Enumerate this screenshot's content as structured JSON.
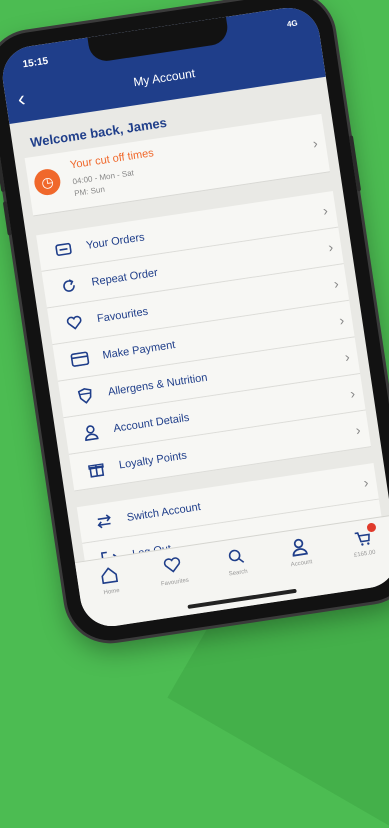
{
  "status": {
    "time": "15:15",
    "signal": "4G"
  },
  "header": {
    "title": "My Account",
    "back_icon": "chevron-left-icon"
  },
  "welcome": "Welcome back, James",
  "cutoff": {
    "title": "Your cut off times",
    "line1": "04:00 - Mon - Sat",
    "line2": "PM: Sun",
    "icon": "clock-icon"
  },
  "menu": [
    {
      "label": "Your Orders",
      "icon": "box-icon"
    },
    {
      "label": "Repeat Order",
      "icon": "repeat-icon"
    },
    {
      "label": "Favourites",
      "icon": "heart-icon"
    },
    {
      "label": "Make Payment",
      "icon": "card-icon"
    },
    {
      "label": "Allergens & Nutrition",
      "icon": "shield-icon"
    },
    {
      "label": "Account Details",
      "icon": "user-icon"
    },
    {
      "label": "Loyalty Points",
      "icon": "gift-icon"
    },
    {
      "label": "Switch Account",
      "icon": "switch-icon"
    },
    {
      "label": "Log Out",
      "icon": "logout-icon"
    }
  ],
  "tabs": [
    {
      "label": "Home",
      "icon": "home-icon"
    },
    {
      "label": "Favourites",
      "icon": "heart-icon"
    },
    {
      "label": "Search",
      "icon": "search-icon"
    },
    {
      "label": "Account",
      "icon": "user-icon"
    },
    {
      "label": "£165.00",
      "icon": "basket-icon"
    }
  ],
  "colors": {
    "brand": "#1f3e8a",
    "accent": "#f0682b",
    "background": "#4cbc52"
  }
}
